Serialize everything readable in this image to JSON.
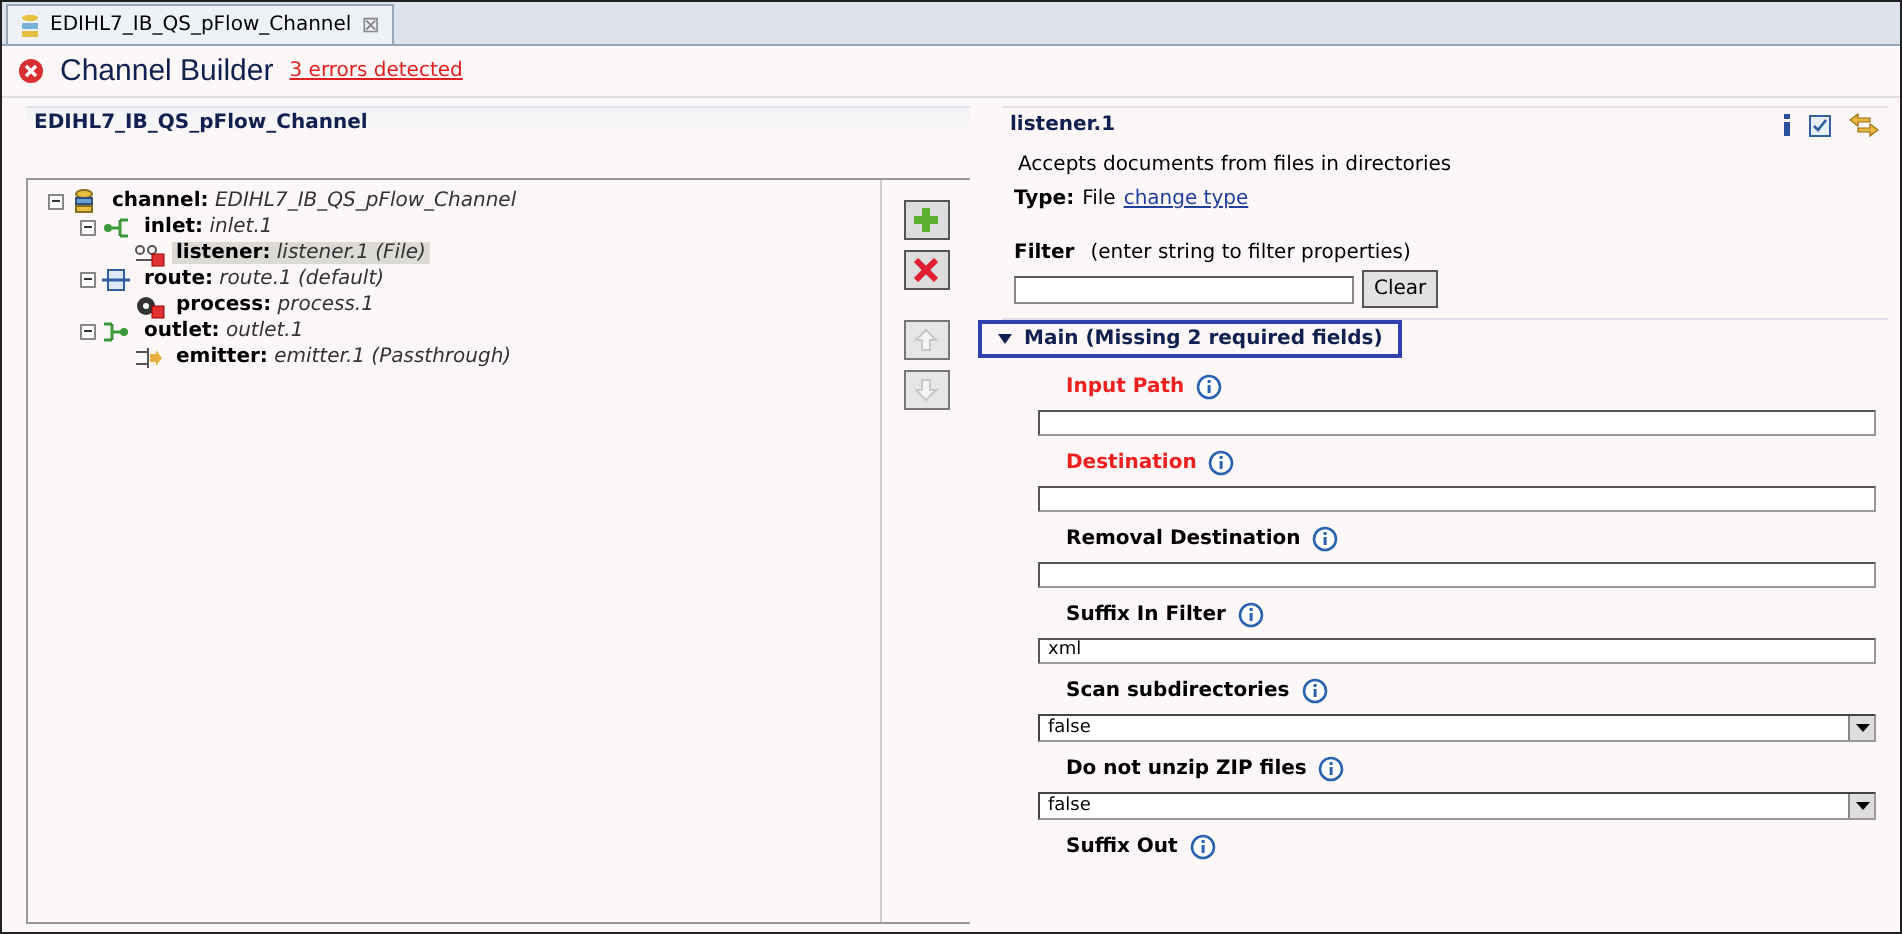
{
  "editor_tab": {
    "title": "EDIHL7_IB_QS_pFlow_Channel",
    "close": "⊠"
  },
  "header": {
    "title": "Channel Builder",
    "errors_link": "3 errors detected"
  },
  "left_panel": {
    "title": "EDIHL7_IB_QS_pFlow_Channel",
    "tree": [
      {
        "kind": "channel",
        "label": "channel:",
        "value": "EDIHL7_IB_QS_pFlow_Channel",
        "expanded": true,
        "selected": false,
        "error": false,
        "children": [
          {
            "kind": "inlet",
            "label": "inlet:",
            "value": "inlet.1",
            "expanded": true,
            "selected": false,
            "error": false,
            "children": [
              {
                "kind": "listener",
                "label": "listener:",
                "value": "listener.1 (File)",
                "selected": true,
                "error": true
              }
            ]
          },
          {
            "kind": "route",
            "label": "route:",
            "value": "route.1 (default)",
            "expanded": true,
            "selected": false,
            "error": false,
            "children": [
              {
                "kind": "process",
                "label": "process:",
                "value": "process.1",
                "selected": false,
                "error": true
              }
            ]
          },
          {
            "kind": "outlet",
            "label": "outlet:",
            "value": "outlet.1",
            "expanded": true,
            "selected": false,
            "error": false,
            "children": [
              {
                "kind": "emitter",
                "label": "emitter:",
                "value": "emitter.1 (Passthrough)",
                "selected": false,
                "error": false
              }
            ]
          }
        ]
      }
    ],
    "buttons": [
      {
        "kind": "add",
        "disabled": false
      },
      {
        "kind": "delete",
        "disabled": false
      },
      {
        "kind": "up",
        "disabled": true
      },
      {
        "kind": "down",
        "disabled": true
      }
    ]
  },
  "right_panel": {
    "title": "listener.1",
    "description": "Accepts documents from files in directories",
    "type_label": "Type:",
    "type_value": "File",
    "change_type_link": "change type",
    "filter": {
      "label": "Filter",
      "hint": "(enter string to filter properties)",
      "clear_button": "Clear"
    },
    "section": {
      "title": "Main (Missing 2 required fields)",
      "expanded": true,
      "fields": [
        {
          "kind": "text",
          "label": "Input Path",
          "required": true
        },
        {
          "kind": "text",
          "label": "Destination",
          "required": true
        },
        {
          "kind": "text",
          "label": "Removal Destination",
          "required": false
        },
        {
          "kind": "text",
          "label": "Suffix In Filter",
          "required": false,
          "value": "xml"
        },
        {
          "kind": "select",
          "label": "Scan subdirectories",
          "required": false,
          "value": "false"
        },
        {
          "kind": "select",
          "label": "Do not unzip ZIP files",
          "required": false,
          "value": "false"
        },
        {
          "kind": "label",
          "label": "Suffix Out",
          "required": false
        }
      ]
    }
  }
}
